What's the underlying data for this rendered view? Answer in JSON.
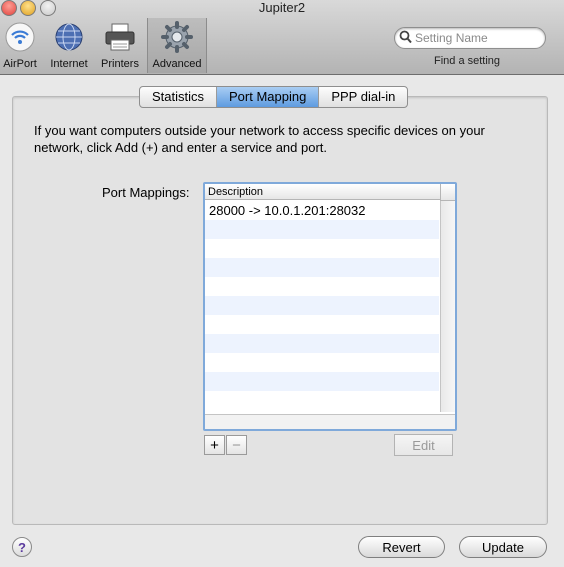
{
  "window": {
    "title": "Jupiter2"
  },
  "toolbar": {
    "items": [
      {
        "label": "AirPort",
        "icon": "airport-icon"
      },
      {
        "label": "Internet",
        "icon": "internet-globe-icon"
      },
      {
        "label": "Printers",
        "icon": "printer-icon"
      },
      {
        "label": "Advanced",
        "icon": "gear-icon"
      }
    ],
    "search": {
      "placeholder": "Setting Name",
      "value": ""
    },
    "find_label": "Find a setting"
  },
  "tabs": [
    {
      "label": "Statistics",
      "active": false
    },
    {
      "label": "Port Mapping",
      "active": true
    },
    {
      "label": "PPP dial-in",
      "active": false
    }
  ],
  "main": {
    "description": "If you want computers outside your network to access specific devices on your network, click Add (+) and enter a service and port.",
    "port_mappings_label": "Port Mappings:",
    "table": {
      "column_header": "Description",
      "rows": [
        "28000 -> 10.0.1.201:28032"
      ]
    },
    "add_label": "+",
    "remove_label": "−",
    "edit_label": "Edit"
  },
  "footer": {
    "help_label": "?",
    "revert_label": "Revert",
    "update_label": "Update"
  },
  "colors": {
    "close": "#e0443e",
    "minimize": "#dea123",
    "zoom": "#c8c8c8",
    "selection": "#5e9be0",
    "row_alt": "#edf3fe"
  }
}
